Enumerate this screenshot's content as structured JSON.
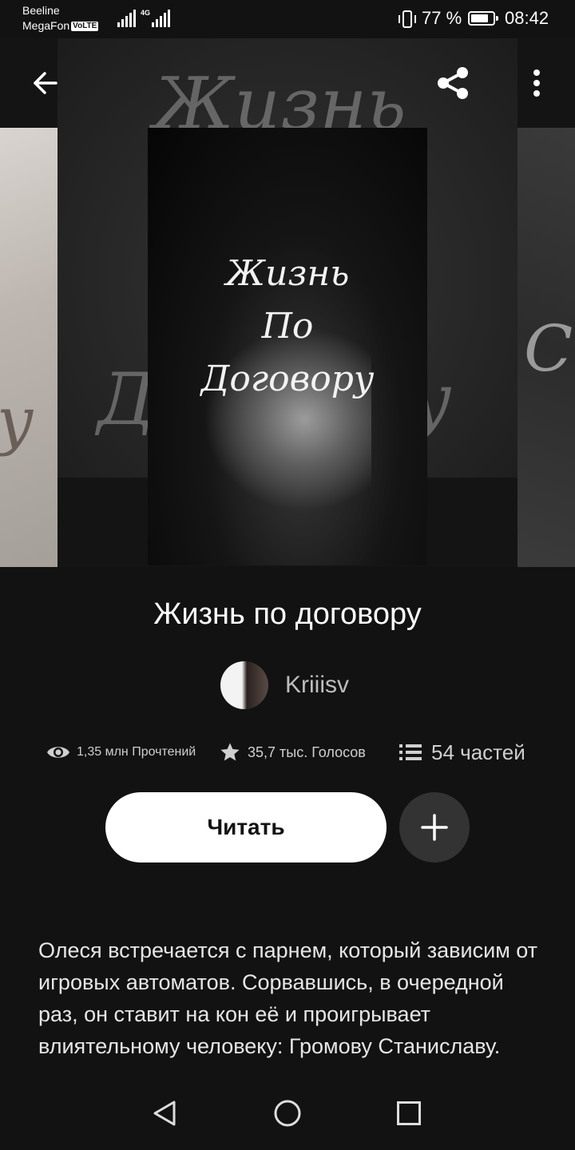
{
  "status_bar": {
    "carrier1": "Beeline",
    "carrier2": "MegaFon",
    "volte": "VoLTE",
    "network": "4G",
    "battery": "77 %",
    "battery_level": 0.77,
    "time": "08:42"
  },
  "hero": {
    "cover_title_line1": "Жизнь",
    "cover_title_line2": "По",
    "cover_title_line3": "Договору",
    "left_cover_text": "у",
    "right_cover_text": "С"
  },
  "icons": {
    "back": "arrow-left-icon",
    "share": "share-icon",
    "more": "more-vertical-icon",
    "views": "eye-icon",
    "votes": "star-icon",
    "parts": "list-icon",
    "add": "plus-icon",
    "nav_back": "triangle-back-icon",
    "nav_home": "circle-home-icon",
    "nav_recents": "square-recents-icon"
  },
  "story": {
    "title": "Жизнь по договору",
    "author": "Kriiisv",
    "views": "1,35 млн Прочтений",
    "votes": "35,7 тыс. Голосов",
    "parts": "54 частей",
    "read_label": "Читать",
    "description": "Олеся встречается с парнем, который зависим от игровых автоматов. Сорвавшись, в очередной раз, он ставит на кон её и проигрывает влиятельному человеку: Громову Станиславу."
  },
  "colors": {
    "background": "#121212",
    "button_bg": "#ffffff",
    "add_button_bg": "#333333",
    "muted_text": "#bdbdbd"
  }
}
